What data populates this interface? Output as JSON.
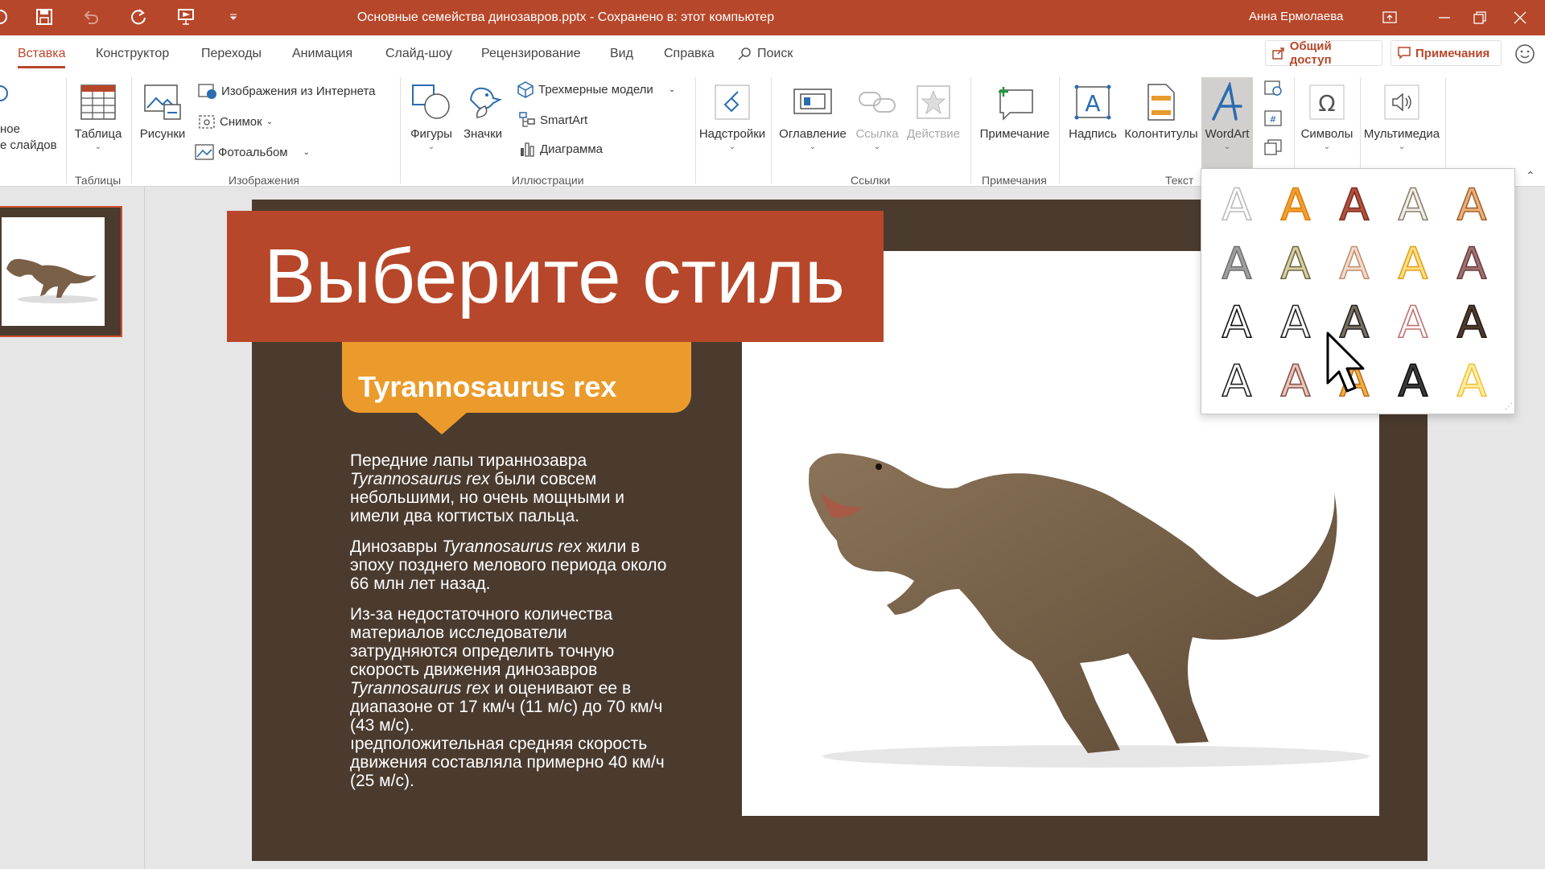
{
  "titlebar": {
    "document": "Основные семейства динозавров.pptx  -  Сохранено в: этот компьютер",
    "user": "Анна Ермолаева",
    "icons": [
      "autosave-icon",
      "save-icon",
      "undo-icon",
      "redo-icon",
      "present-icon",
      "customize-icon",
      "ribbon-display-icon",
      "minimize-icon",
      "restore-icon",
      "close-icon"
    ]
  },
  "tabs": {
    "items": [
      "Вставка",
      "Конструктор",
      "Переходы",
      "Анимация",
      "Слайд-шоу",
      "Рецензирование",
      "Вид",
      "Справка"
    ],
    "active": "Вставка",
    "search": "Поиск",
    "share": "Общий доступ",
    "comments": "Примечания"
  },
  "ribbon": {
    "new_slide_line1": "ное",
    "new_slide_line2": "е слайдов",
    "table": "Таблица",
    "pictures": "Рисунки",
    "online_pictures": "Изображения из Интернета",
    "screenshot": "Снимок",
    "photo_album": "Фотоальбом",
    "shapes": "Фигуры",
    "icons": "Значки",
    "models_3d": "Трехмерные модели",
    "smartart": "SmartArt",
    "chart": "Диаграмма",
    "addins": "Надстройки",
    "toc": "Оглавление",
    "link": "Ссылка",
    "action": "Действие",
    "comment": "Примечание",
    "textbox": "Надпись",
    "header_footer": "Колонтитулы",
    "wordart": "WordArt",
    "symbols": "Символы",
    "media": "Мультимедиа",
    "groups": {
      "tables": "Таблицы",
      "images": "Изображения",
      "illustrations": "Иллюстрации",
      "links": "Ссылки",
      "comments": "Примечания",
      "text": "Текст"
    }
  },
  "slide": {
    "banner": "Выберите стиль",
    "subtitle": "Tyrannosaurus rex",
    "p1_a": "Передние лапы тираннозавра ",
    "p1_i": "Tyrannosaurus rex",
    "p1_b": " были совсем небольшими, но очень мощными и имели два когтистых пальца.",
    "p2_a": "Динозавры ",
    "p2_i": "Tyrannosaurus rex",
    "p2_b": " жили в эпоху позднего мелового периода около 66 млн лет назад.",
    "p3_a": "Из-за недостаточного количества материалов исследователи затрудняются определить точную скорость движения динозавров ",
    "p3_i": "Tyrannosaurus rex",
    "p3_b": " и оценивают ее в диапазоне от 17 км/ч (11 м/с) до 70 км/ч (43 м/с).",
    "p3_c": "ıредположительная средняя скорость движения составляла примерно 40 км/ч (25 м/с)."
  },
  "wordart_gallery": {
    "glyph": "A",
    "styles": [
      [
        "#ffffff",
        "#bbbbbb"
      ],
      [
        "#f0a030",
        "#e08010"
      ],
      [
        "#b35040",
        "#7a3020"
      ],
      [
        "#f3efe6",
        "#8a8170"
      ],
      [
        "#e8b37a",
        "#a86030"
      ],
      [
        "#a0a0a0",
        "#707070"
      ],
      [
        "#d8d0a0",
        "#6e6848"
      ],
      [
        "#f2dccc",
        "#c09070"
      ],
      [
        "#ffe080",
        "#e0a020"
      ],
      [
        "#a07070",
        "#6a4040"
      ],
      [
        "#ffffff",
        "#111111"
      ],
      [
        "#ffffff",
        "#222222"
      ],
      [
        "#7a7060",
        "#222222"
      ],
      [
        "#ffffff",
        "#c07070"
      ],
      [
        "#4b3b2f",
        "#2a1e16"
      ],
      [
        "#ffffff",
        "#222222"
      ],
      [
        "#e8c8b8",
        "#8a5050"
      ],
      [
        "#f2b040",
        "#c07020"
      ],
      [
        "#3a3a3a",
        "#111111"
      ],
      [
        "#fff0a0",
        "#f0c040"
      ]
    ]
  }
}
